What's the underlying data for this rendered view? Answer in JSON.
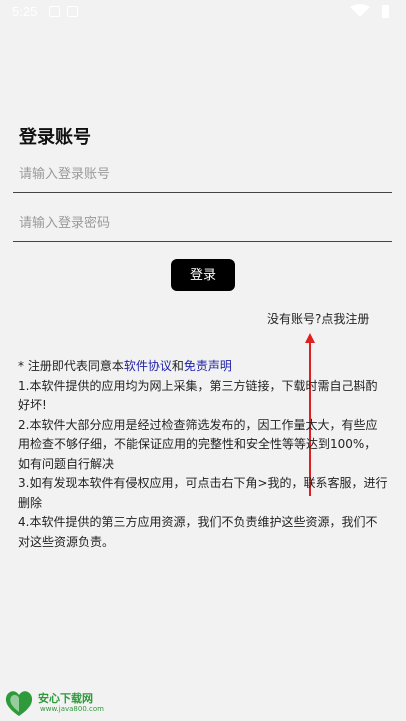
{
  "status_bar": {
    "time": "5:25",
    "icons": [
      "notification-icon",
      "photo-icon",
      "wifi-icon",
      "battery-icon"
    ]
  },
  "login": {
    "title": "登录账号",
    "account_placeholder": "请输入登录账号",
    "password_placeholder": "请输入登录密码",
    "submit_label": "登录",
    "register_link": "没有账号?点我注册"
  },
  "notice": {
    "prefix": "* 注册即代表同意本",
    "agreement_link": "软件协议",
    "and": "和",
    "disclaimer_link": "免责声明",
    "items": [
      "1.本软件提供的应用均为网上采集，第三方链接，下载时需自己斟酌好坏!",
      "2.本软件大部分应用是经过检查筛选发布的，因工作量太大，有些应用检查不够仔细，不能保证应用的完整性和安全性等等达到100%，如有问题自行解决",
      "3.如有发现本软件有侵权应用，可点击右下角>我的，联系客服，进行删除",
      "4.本软件提供的第三方应用资源，我们不负责维护这些资源，我们不对这些资源负责。"
    ]
  },
  "watermark": {
    "logo_text": "安心下载",
    "name": "安心下载网",
    "url": "www.java800.com"
  },
  "colors": {
    "background": "#f2f2f2",
    "button": "#000000",
    "link": "#2222aa",
    "arrow": "#e02020",
    "watermark": "#2e9a3a"
  }
}
